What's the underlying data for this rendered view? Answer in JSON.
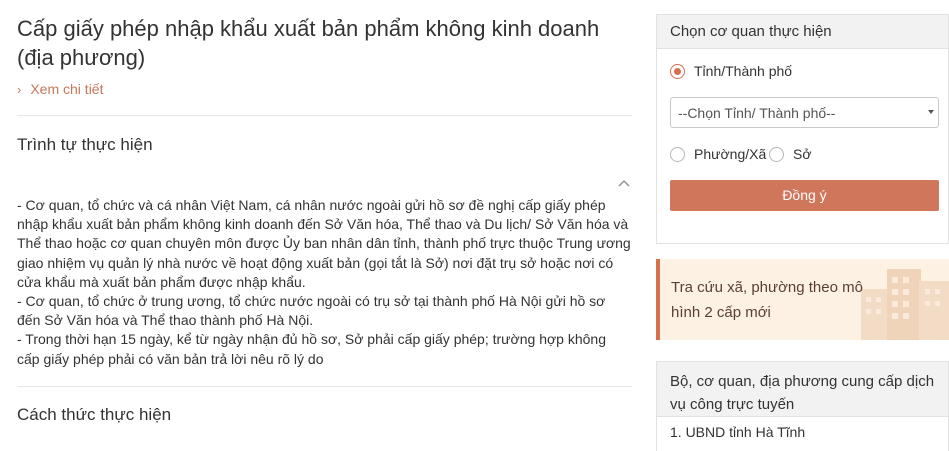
{
  "main": {
    "title": "Cấp giấy phép nhập khẩu xuất bản phẩm không kinh doanh (địa phương)",
    "detail_link": "Xem chi tiết",
    "sections": [
      {
        "title": "Trình tự thực hiện",
        "paragraphs": [
          "- Cơ quan, tổ chức và cá nhân Việt Nam, cá nhân nước ngoài gửi hồ sơ đề nghị cấp giấy phép nhập khẩu xuất bản phẩm không kinh doanh đến Sở Văn hóa, Thể thao và Du lịch/ Sở Văn hóa và Thể thao hoặc cơ quan chuyên môn được Ủy ban nhân dân tỉnh, thành phố trực thuộc Trung ương giao nhiệm vụ quản lý nhà nước về hoạt động xuất bản (gọi tắt là Sở) nơi đặt trụ sở hoặc nơi có cửa khẩu mà xuất bản phẩm được nhập khẩu.",
          "- Cơ quan, tổ chức ở trung ương, tổ chức nước ngoài có trụ sở tại thành phố Hà Nội gửi hồ sơ đến Sở Văn hóa và Thể thao thành phố Hà Nội.",
          "- Trong thời hạn 15 ngày, kể từ ngày nhận đủ hồ sơ, Sở phải cấp giấy phép; trường hợp không cấp giấy phép phải có văn bản trả lời nêu rõ lý do"
        ]
      },
      {
        "title": "Cách thức thực hiện"
      }
    ]
  },
  "sidebar": {
    "agency_panel": {
      "title": "Chọn cơ quan thực hiện",
      "option_province": "Tỉnh/Thành phố",
      "option_ward": "Phường/Xã",
      "option_department": "Sở",
      "select_value": "--Chọn Tỉnh/ Thành phố--",
      "submit_label": "Đồng ý"
    },
    "banner": {
      "text": "Tra cứu xã, phường theo mô hình 2 cấp mới"
    },
    "providers_panel": {
      "title": "Bộ, cơ quan, địa phương cung cấp dịch vụ công trực tuyến",
      "items": [
        "1. UBND tỉnh Hà Tĩnh"
      ]
    }
  },
  "colors": {
    "accent": "#d0765a",
    "link": "#c8765a",
    "banner_bg": "#fdf1e3",
    "panel_head_bg": "#f2f2f2"
  },
  "icons": {
    "detail_link": "chevron-right-icon",
    "collapse": "chevron-up-icon",
    "select": "caret-down-icon",
    "banner": "buildings-icon"
  }
}
